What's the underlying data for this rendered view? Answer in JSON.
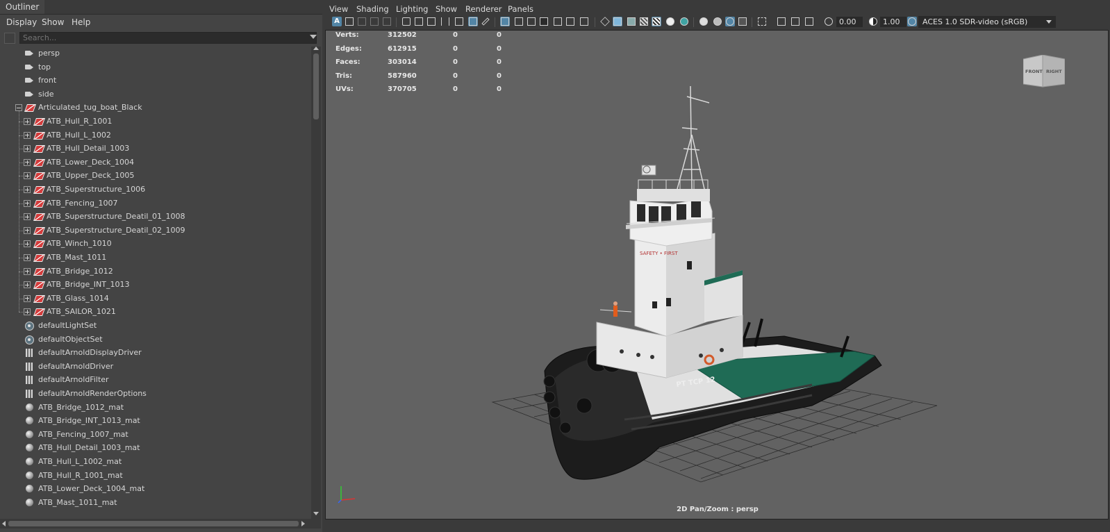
{
  "outliner": {
    "tab": "Outliner",
    "menu": [
      "Display",
      "Show",
      "Help"
    ],
    "search_placeholder": "Search...",
    "items": [
      {
        "label": "persp",
        "icon": "camera-icon"
      },
      {
        "label": "top",
        "icon": "camera-icon"
      },
      {
        "label": "front",
        "icon": "camera-icon"
      },
      {
        "label": "side",
        "icon": "camera-icon"
      },
      {
        "label": "Articulated_tug_boat_Black",
        "icon": "transform-icon"
      },
      {
        "label": "ATB_Hull_R_1001",
        "icon": "transform-icon"
      },
      {
        "label": "ATB_Hull_L_1002",
        "icon": "transform-icon"
      },
      {
        "label": "ATB_Hull_Detail_1003",
        "icon": "transform-icon"
      },
      {
        "label": "ATB_Lower_Deck_1004",
        "icon": "transform-icon"
      },
      {
        "label": "ATB_Upper_Deck_1005",
        "icon": "transform-icon"
      },
      {
        "label": "ATB_Superstructure_1006",
        "icon": "transform-icon"
      },
      {
        "label": "ATB_Fencing_1007",
        "icon": "transform-icon"
      },
      {
        "label": "ATB_Superstructure_Deatil_01_1008",
        "icon": "transform-icon"
      },
      {
        "label": "ATB_Superstructure_Deatil_02_1009",
        "icon": "transform-icon"
      },
      {
        "label": "ATB_Winch_1010",
        "icon": "transform-icon"
      },
      {
        "label": "ATB_Mast_1011",
        "icon": "transform-icon"
      },
      {
        "label": "ATB_Bridge_1012",
        "icon": "transform-icon"
      },
      {
        "label": "ATB_Bridge_INT_1013",
        "icon": "transform-icon"
      },
      {
        "label": "ATB_Glass_1014",
        "icon": "transform-icon"
      },
      {
        "label": "ATB_SAILOR_1021",
        "icon": "transform-icon"
      },
      {
        "label": "defaultLightSet",
        "icon": "set-icon"
      },
      {
        "label": "defaultObjectSet",
        "icon": "set-icon"
      },
      {
        "label": "defaultArnoldDisplayDriver",
        "icon": "node-icon"
      },
      {
        "label": "defaultArnoldDriver",
        "icon": "node-icon"
      },
      {
        "label": "defaultArnoldFilter",
        "icon": "node-icon"
      },
      {
        "label": "defaultArnoldRenderOptions",
        "icon": "node-icon"
      },
      {
        "label": "ATB_Bridge_1012_mat",
        "icon": "material-icon"
      },
      {
        "label": "ATB_Bridge_INT_1013_mat",
        "icon": "material-icon"
      },
      {
        "label": "ATB_Fencing_1007_mat",
        "icon": "material-icon"
      },
      {
        "label": "ATB_Hull_Detail_1003_mat",
        "icon": "material-icon"
      },
      {
        "label": "ATB_Hull_L_1002_mat",
        "icon": "material-icon"
      },
      {
        "label": "ATB_Hull_R_1001_mat",
        "icon": "material-icon"
      },
      {
        "label": "ATB_Lower_Deck_1004_mat",
        "icon": "material-icon"
      },
      {
        "label": "ATB_Mast_1011_mat",
        "icon": "material-icon"
      }
    ]
  },
  "viewport": {
    "menu": [
      "View",
      "Shading",
      "Lighting",
      "Show",
      "Renderer",
      "Panels"
    ],
    "exposure": "0.00",
    "gamma": "1.00",
    "color_space": "ACES 1.0 SDR-video (sRGB)",
    "camera_label": "2D Pan/Zoom : persp",
    "view_cube": {
      "front": "FRONT",
      "right": "RIGHT"
    },
    "hull_text": "PT TCP  12",
    "bridge_text": "SAFETY • FIRST",
    "stats": [
      {
        "label": "Verts:",
        "values": [
          "312502",
          "0",
          "0"
        ]
      },
      {
        "label": "Edges:",
        "values": [
          "612915",
          "0",
          "0"
        ]
      },
      {
        "label": "Faces:",
        "values": [
          "303014",
          "0",
          "0"
        ]
      },
      {
        "label": "Tris:",
        "values": [
          "587960",
          "0",
          "0"
        ]
      },
      {
        "label": "UVs:",
        "values": [
          "370705",
          "0",
          "0"
        ]
      }
    ]
  },
  "colors": {
    "viewport_bg": "#626262",
    "panel_bg": "#444444",
    "highlight": "#5285a6",
    "hull": "#1c1c1c",
    "superstructure": "#e9e9e9",
    "deck": "#1f6b55"
  }
}
